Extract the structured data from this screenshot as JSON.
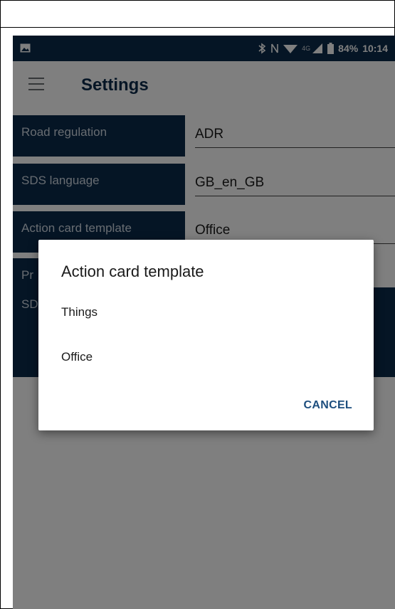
{
  "statusbar": {
    "icons_left": [
      "image-icon"
    ],
    "icons_right": [
      "bluetooth-icon",
      "nfc-icon",
      "wifi-icon",
      "4g-signal-icon",
      "battery-icon"
    ],
    "network_label": "4G",
    "battery": "84%",
    "time": "10:14"
  },
  "appbar": {
    "title": "Settings"
  },
  "settings": [
    {
      "label": "Road regulation",
      "value": "ADR"
    },
    {
      "label": "SDS language",
      "value": "GB_en_GB"
    },
    {
      "label": "Action card template",
      "value": "Office"
    },
    {
      "label": "Pr",
      "value": ""
    },
    {
      "label": "SD",
      "value": ""
    }
  ],
  "dialog": {
    "title": "Action card template",
    "options": [
      "Things",
      "Office"
    ],
    "cancel_label": "CANCEL"
  },
  "colors": {
    "primary": "#0b2a4a",
    "accent": "#1d4e7e"
  }
}
